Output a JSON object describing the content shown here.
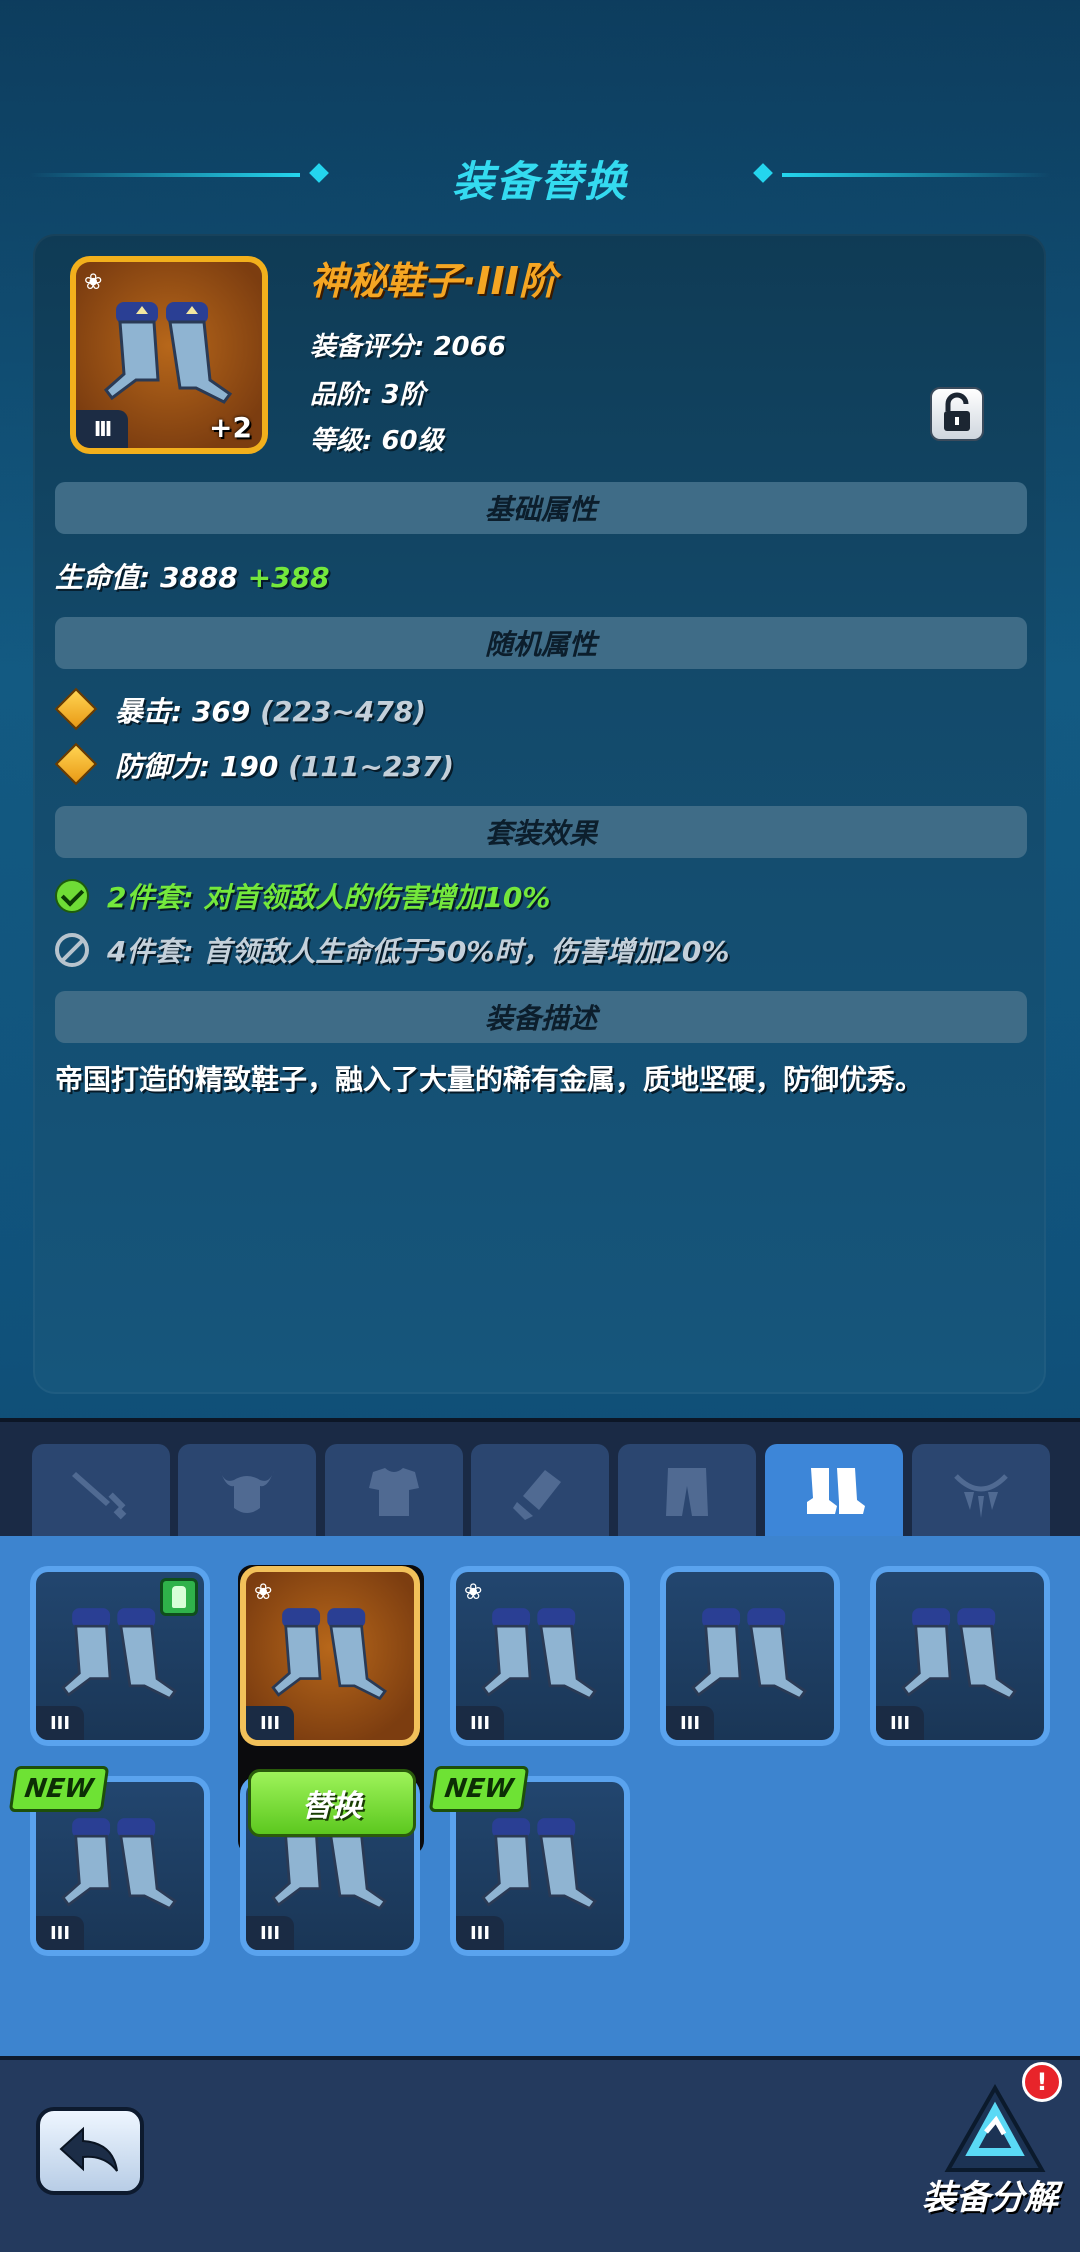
{
  "header": {
    "title": "装备替换"
  },
  "item": {
    "name": "神秘鞋子·III阶",
    "tier_badge": "III",
    "plus": "+2",
    "score_label": "装备评分:",
    "score_value": "2066",
    "quality_label": "品阶:",
    "quality_value": "3阶",
    "level_label": "等级:",
    "level_value": "60级"
  },
  "sections": {
    "base": "基础属性",
    "random": "随机属性",
    "set": "套装效果",
    "desc": "装备描述"
  },
  "base_attrs": [
    {
      "label": "生命值:",
      "value": "3888",
      "bonus": "+388"
    }
  ],
  "random_attrs": [
    {
      "label": "暴击:",
      "value": "369",
      "range": "(223~478)"
    },
    {
      "label": "防御力:",
      "value": "190",
      "range": "(111~237)"
    }
  ],
  "set_effects": [
    {
      "text": "2件套: 对首领敌人的伤害增加10%",
      "active": true
    },
    {
      "text": "4件套: 首领敌人生命低于50%时，伤害增加20%",
      "active": false
    }
  ],
  "description": "帝国打造的精致鞋子，融入了大量的稀有金属，质地坚硬，防御优秀。",
  "tabs": [
    {
      "icon": "sword-icon",
      "active": false
    },
    {
      "icon": "horned-helmet-icon",
      "active": false
    },
    {
      "icon": "armor-icon",
      "active": false
    },
    {
      "icon": "bracer-icon",
      "active": false
    },
    {
      "icon": "pants-icon",
      "active": false
    },
    {
      "icon": "boots-icon",
      "active": true
    },
    {
      "icon": "necklace-icon",
      "active": false
    }
  ],
  "inventory": [
    {
      "tier": "III",
      "equipped": true,
      "new": false,
      "selected": false,
      "quality_pin": false
    },
    {
      "tier": "III",
      "equipped": false,
      "new": false,
      "selected": true,
      "quality_pin": true
    },
    {
      "tier": "III",
      "equipped": false,
      "new": false,
      "selected": false,
      "quality_pin": true
    },
    {
      "tier": "III",
      "equipped": false,
      "new": false,
      "selected": false,
      "quality_pin": false
    },
    {
      "tier": "III",
      "equipped": false,
      "new": false,
      "selected": false,
      "quality_pin": false
    },
    {
      "tier": "III",
      "equipped": false,
      "new": true,
      "selected": false,
      "quality_pin": false
    },
    {
      "tier": "III",
      "equipped": false,
      "new": true,
      "selected": false,
      "quality_pin": false
    },
    {
      "tier": "III",
      "equipped": false,
      "new": true,
      "selected": false,
      "quality_pin": false
    }
  ],
  "labels": {
    "new_tag": "NEW",
    "replace_button": "替换",
    "decompose": "装备分解",
    "alert": "!"
  },
  "colors": {
    "title": "#34dbf0",
    "item_name": "#f5a623",
    "bonus_green": "#74e83c",
    "panel_blue": "#3d84cf"
  }
}
